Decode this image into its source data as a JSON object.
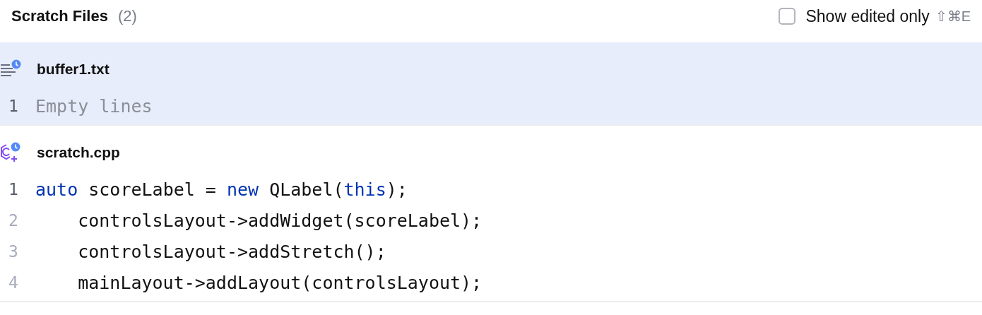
{
  "header": {
    "title": "Scratch Files",
    "count": "(2)",
    "filter": {
      "label": "Show edited only",
      "checked": false,
      "shortcut": "⇧⌘E"
    }
  },
  "files": [
    {
      "name": "buffer1.txt",
      "kind": "text",
      "selected": true,
      "lines": [
        {
          "number": "1",
          "current": true,
          "tokens": [
            {
              "text": "Empty lines",
              "kind": "placeholder"
            }
          ]
        }
      ]
    },
    {
      "name": "scratch.cpp",
      "kind": "cpp",
      "selected": false,
      "lines": [
        {
          "number": "1",
          "current": true,
          "tokens": [
            {
              "text": "auto",
              "kind": "keyword"
            },
            {
              "text": " scoreLabel = ",
              "kind": "plain"
            },
            {
              "text": "new",
              "kind": "keyword"
            },
            {
              "text": " QLabel(",
              "kind": "plain"
            },
            {
              "text": "this",
              "kind": "keyword"
            },
            {
              "text": ");",
              "kind": "plain"
            }
          ]
        },
        {
          "number": "2",
          "current": false,
          "tokens": [
            {
              "text": "    controlsLayout->addWidget(scoreLabel);",
              "kind": "plain"
            }
          ]
        },
        {
          "number": "3",
          "current": false,
          "tokens": [
            {
              "text": "    controlsLayout->addStretch();",
              "kind": "plain"
            }
          ]
        },
        {
          "number": "4",
          "current": false,
          "tokens": [
            {
              "text": "    mainLayout->addLayout(controlsLayout);",
              "kind": "plain"
            }
          ]
        }
      ]
    }
  ]
}
